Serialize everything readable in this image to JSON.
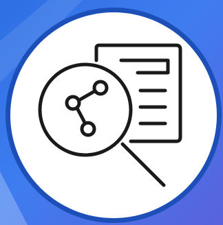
{
  "icon": {
    "name": "document-search-share-icon",
    "background_colors": [
      "#2f6fe2",
      "#4a86f0",
      "#6f6fe0"
    ],
    "circle_fill": "#ffffff",
    "circle_border": "#1d4fb8",
    "stroke_color": "#1a1a1a"
  }
}
